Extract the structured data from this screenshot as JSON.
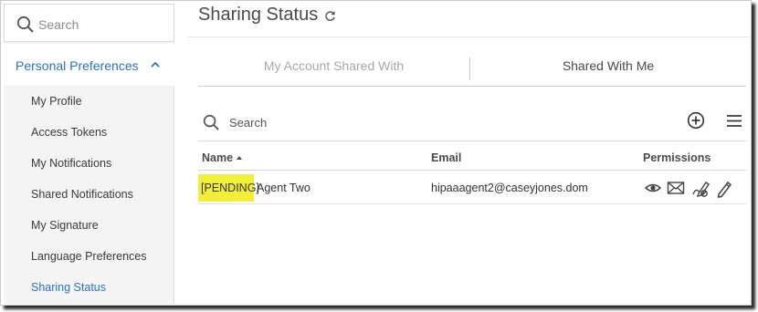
{
  "sidebar": {
    "search_placeholder": "Search",
    "section_label": "Personal Preferences",
    "items": [
      {
        "label": "My Profile"
      },
      {
        "label": "Access Tokens"
      },
      {
        "label": "My Notifications"
      },
      {
        "label": "Shared Notifications"
      },
      {
        "label": "My Signature"
      },
      {
        "label": "Language Preferences"
      },
      {
        "label": "Sharing Status"
      }
    ],
    "active_item": "Sharing Status"
  },
  "main": {
    "title": "Sharing Status",
    "tabs": [
      {
        "label": "My Account Shared With"
      },
      {
        "label": "Shared With Me"
      }
    ],
    "search_placeholder": "Search",
    "table": {
      "columns": {
        "name": "Name",
        "email": "Email",
        "permissions": "Permissions"
      },
      "rows": [
        {
          "status_tag": "[PENDING]",
          "name": "Agent Two",
          "email": "hipaaagent2@caseyjones.dom",
          "permissions": [
            "eye-icon",
            "envelope-icon",
            "sign-icon",
            "pencil-icon"
          ]
        }
      ]
    }
  },
  "colors": {
    "accent": "#2a73c4",
    "highlight": "#f3ee3a"
  }
}
